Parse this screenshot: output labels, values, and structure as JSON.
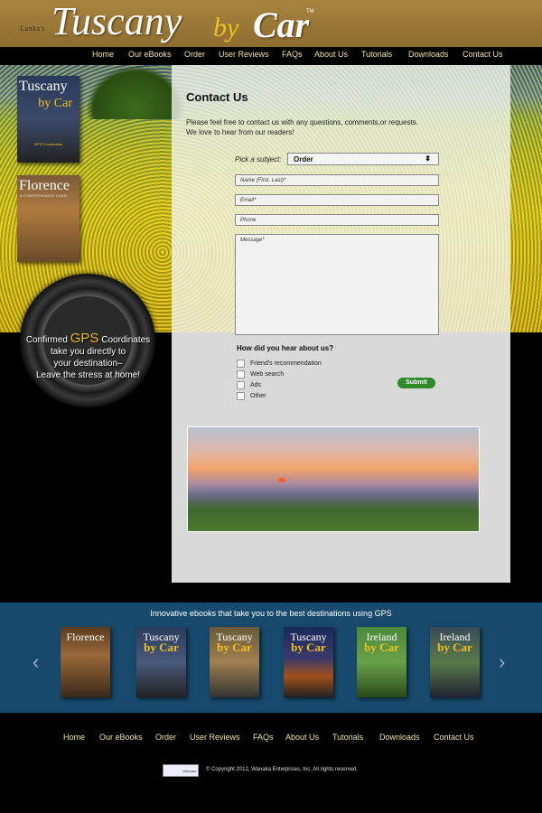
{
  "brand": {
    "small": "Lanka's",
    "tuscany": "Tuscany",
    "by": "by",
    "car": "Car",
    "tm": "TM"
  },
  "nav": [
    "Home",
    "Our eBooks",
    "Order",
    "User Reviews",
    "FAQs",
    "About Us",
    "Tutorials",
    "Downloads",
    "Contact Us"
  ],
  "sidebar": {
    "book1": {
      "title1": "Tuscany",
      "title2": "by Car",
      "sub": "GPS Coordinates"
    },
    "book2": {
      "title": "Florence",
      "sub": "A COMPREHENSIVE GUIDE"
    },
    "wheel_line1a": "Confirmed",
    "wheel_gps": "GPS",
    "wheel_line1b": "Coordinates",
    "wheel_line2": "take you directly to",
    "wheel_line3": "your destination–",
    "wheel_line4": "Leave the stress at home!"
  },
  "contact": {
    "title": "Contact Us",
    "intro1": "Please feel free to contact us with any questions, comments,or requests.",
    "intro2": "We love to hear from our readers!",
    "subject_label": "Pick a subject:",
    "subject_value": "Order",
    "name_placeholder": "Name (First, Last)*",
    "email_placeholder": "Email*",
    "phone_placeholder": "Phone",
    "message_placeholder": "Message*",
    "hear_title": "How did you hear about us?",
    "options": [
      "Friend's recommendation",
      "Web search",
      "Ads",
      "Other"
    ],
    "submit": "Submit"
  },
  "carousel": {
    "title": "Innovative ebooks that take you to the best destinations using GPS",
    "books": [
      {
        "t1": "Florence",
        "t2": ""
      },
      {
        "t1": "Tuscany",
        "t2": "by Car"
      },
      {
        "t1": "Tuscany",
        "t2": "by Car"
      },
      {
        "t1": "Tuscany",
        "t2": "by Car"
      },
      {
        "t1": "Ireland",
        "t2": "by Car"
      },
      {
        "t1": "Ireland",
        "t2": "by Car"
      }
    ]
  },
  "footer": {
    "nav": [
      "Home",
      "Our eBooks",
      "Order",
      "User Reviews",
      "FAQs",
      "About Us",
      "Tutorials",
      "Downloads",
      "Contact Us"
    ],
    "logo": "Wanaka",
    "copyright": "© Copyright 2012, Wanaka Enterprises, Inc.  All rights reserved."
  },
  "colors": {
    "header": "#a8843f",
    "nav_text": "#f3e3a0",
    "carousel_bg": "#174a6c",
    "submit": "#2f8a2a",
    "accent_yellow": "#f0c020"
  }
}
